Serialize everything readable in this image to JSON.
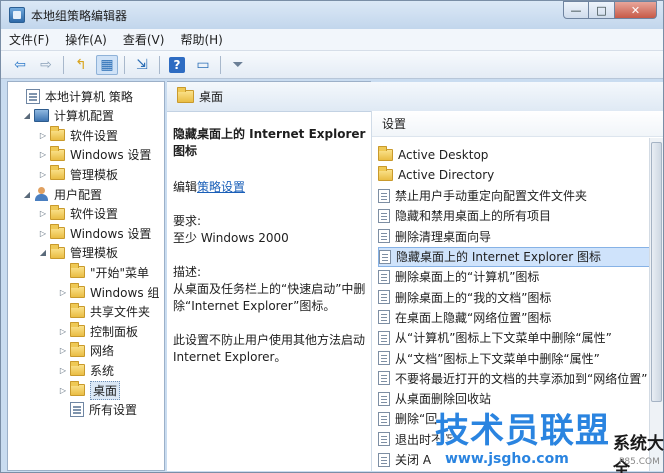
{
  "window": {
    "title": "本地组策略编辑器",
    "controls": {
      "minimize": "—",
      "maximize": "□",
      "close": "✕"
    }
  },
  "menu": [
    "文件(F)",
    "操作(A)",
    "查看(V)",
    "帮助(H)"
  ],
  "toolbar": {
    "icons": [
      "back-arrow-icon",
      "forward-arrow-icon",
      "folder-up-icon",
      "show-hide-tree-icon",
      "export-list-icon",
      "help-icon",
      "properties-icon",
      "filter-icon"
    ],
    "glyphs": {
      "back": "⇦",
      "forward": "⇨",
      "up": "↰",
      "tree": "▦",
      "export": "⇲",
      "help": "?",
      "props": "▭",
      "filter": "⏷"
    }
  },
  "tree": {
    "items": [
      {
        "label": "本地计算机 策略",
        "level": 0,
        "icon": "policy",
        "expander": ""
      },
      {
        "label": "计算机配置",
        "level": 1,
        "icon": "computer",
        "expander": "◢"
      },
      {
        "label": "软件设置",
        "level": 2,
        "icon": "folder",
        "expander": "▷"
      },
      {
        "label": "Windows 设置",
        "level": 2,
        "icon": "folder",
        "expander": "▷"
      },
      {
        "label": "管理模板",
        "level": 2,
        "icon": "folder",
        "expander": "▷"
      },
      {
        "label": "用户配置",
        "level": 1,
        "icon": "user",
        "expander": "◢"
      },
      {
        "label": "软件设置",
        "level": 2,
        "icon": "folder",
        "expander": "▷"
      },
      {
        "label": "Windows 设置",
        "level": 2,
        "icon": "folder",
        "expander": "▷"
      },
      {
        "label": "管理模板",
        "level": 2,
        "icon": "folder",
        "expander": "◢"
      },
      {
        "label": "\"开始\"菜单",
        "level": 3,
        "icon": "folder",
        "expander": ""
      },
      {
        "label": "Windows 组",
        "level": 3,
        "icon": "folder",
        "expander": "▷"
      },
      {
        "label": "共享文件夹",
        "level": 3,
        "icon": "folder",
        "expander": ""
      },
      {
        "label": "控制面板",
        "level": 3,
        "icon": "folder",
        "expander": "▷"
      },
      {
        "label": "网络",
        "level": 3,
        "icon": "folder",
        "expander": "▷"
      },
      {
        "label": "系统",
        "level": 3,
        "icon": "folder",
        "expander": "▷"
      },
      {
        "label": "桌面",
        "level": 3,
        "icon": "folder",
        "expander": "▷",
        "selected": true
      },
      {
        "label": "所有设置",
        "level": 3,
        "icon": "all-settings",
        "expander": ""
      }
    ]
  },
  "details": {
    "header": "桌面",
    "title": "隐藏桌面上的 Internet Explorer 图标",
    "edit_prefix": "编辑",
    "edit_link": "策略设置",
    "requirements_label": "要求:",
    "requirements_value": "至少 Windows 2000",
    "description_label": "描述:",
    "description_text": "从桌面及任务栏上的“快速启动”中删除“Internet Explorer”图标。",
    "note": "此设置不防止用户使用其他方法启动 Internet Explorer。"
  },
  "list": {
    "header": "设置",
    "items": [
      {
        "label": "Active Desktop",
        "type": "folder"
      },
      {
        "label": "Active Directory",
        "type": "folder"
      },
      {
        "label": "禁止用户手动重定向配置文件文件夹",
        "type": "setting"
      },
      {
        "label": "隐藏和禁用桌面上的所有项目",
        "type": "setting"
      },
      {
        "label": "删除清理桌面向导",
        "type": "setting"
      },
      {
        "label": "隐藏桌面上的 Internet Explorer 图标",
        "type": "setting",
        "selected": true
      },
      {
        "label": "删除桌面上的“计算机”图标",
        "type": "setting"
      },
      {
        "label": "删除桌面上的“我的文档”图标",
        "type": "setting"
      },
      {
        "label": "在桌面上隐藏“网络位置”图标",
        "type": "setting"
      },
      {
        "label": "从“计算机”图标上下文菜单中删除“属性”",
        "type": "setting"
      },
      {
        "label": "从“文档”图标上下文菜单中删除“属性”",
        "type": "setting"
      },
      {
        "label": "不要将最近打开的文档的共享添加到“网络位置”",
        "type": "setting"
      },
      {
        "label": "从桌面删除回收站",
        "type": "setting"
      },
      {
        "label": "删除“回",
        "type": "setting"
      },
      {
        "label": "退出时不保",
        "type": "setting"
      },
      {
        "label": "关闭 A",
        "type": "setting"
      }
    ]
  },
  "watermark": {
    "main": "技术员联盟",
    "side": "系统大全",
    "url": "www.jsgho.com",
    "small": "P85.COM"
  }
}
